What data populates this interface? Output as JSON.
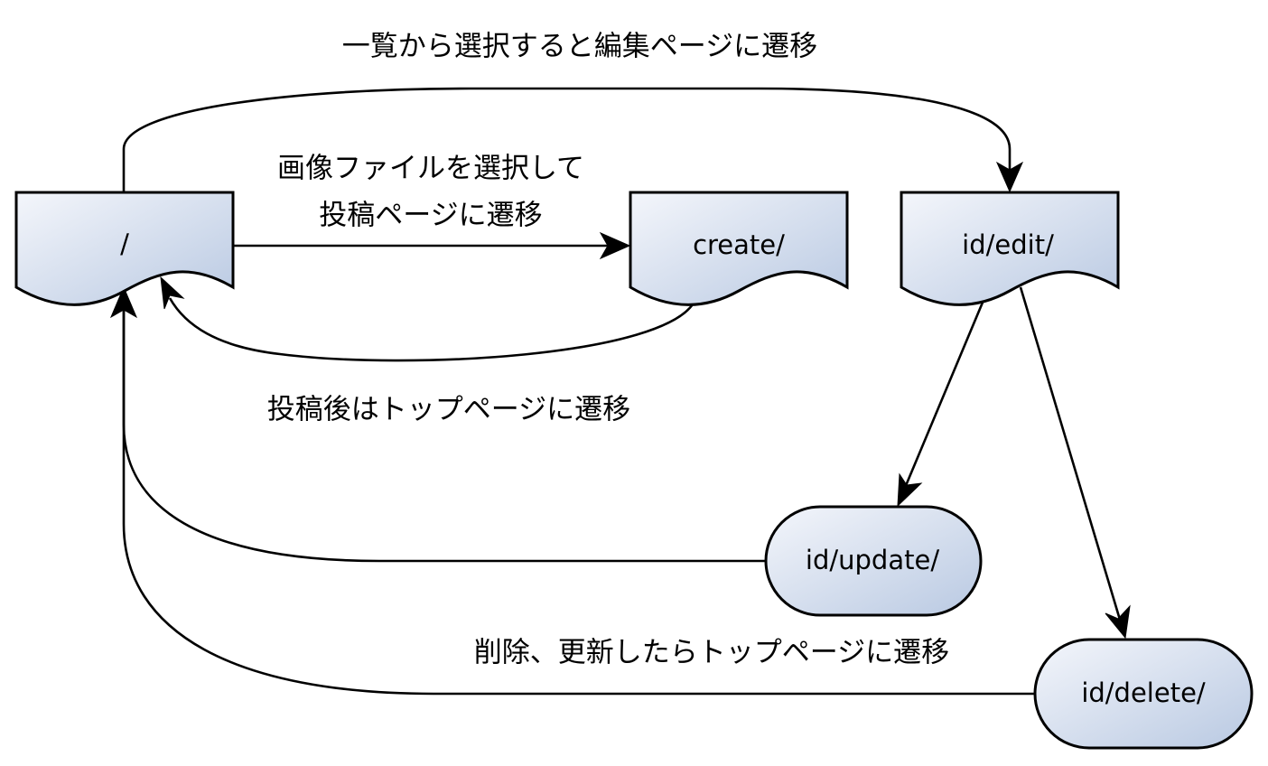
{
  "nodes": {
    "root": {
      "label": "/"
    },
    "create": {
      "label": "create/"
    },
    "edit": {
      "label": "id/edit/"
    },
    "update": {
      "label": "id/update/"
    },
    "delete": {
      "label": "id/delete/"
    }
  },
  "edge_labels": {
    "select_to_edit": "一覧から選択すると編集ページに遷移",
    "select_image_line1": "画像ファイルを選択して",
    "select_image_line2": "投稿ページに遷移",
    "after_post": "投稿後はトップページに遷移",
    "after_delete_update": "削除、更新したらトップページに遷移"
  },
  "colors": {
    "fill_light": "#f4f6fb",
    "fill_dark": "#b9c9e2",
    "stroke": "#000000"
  }
}
